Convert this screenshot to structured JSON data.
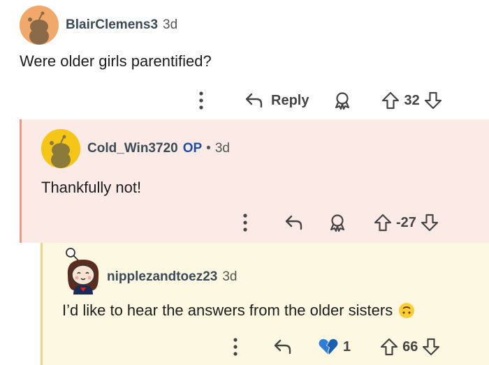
{
  "comments": [
    {
      "username": "BlairClemens3",
      "age": "3d",
      "body": "Were older girls parentified?",
      "reply_label": "Reply",
      "votes": "32",
      "avatar_color": "#f0a96a"
    },
    {
      "username": "Cold_Win3720",
      "op_badge": "OP",
      "separator": "•",
      "age": "3d",
      "body": "Thankfully not!",
      "votes": "-27",
      "avatar_color": "#f5c518"
    },
    {
      "username": "nipplezandtoez23",
      "age": "3d",
      "body": "I’d like to hear the answers from the older sisters",
      "emoji": "🙃",
      "award_count": "1",
      "votes": "66",
      "avatar_color": "#f4efe9"
    }
  ],
  "colors": {
    "op_thread_bg": "#fbeae5",
    "nested_thread_bg": "#fdf8e2",
    "op_blue": "#1c4fa3"
  }
}
